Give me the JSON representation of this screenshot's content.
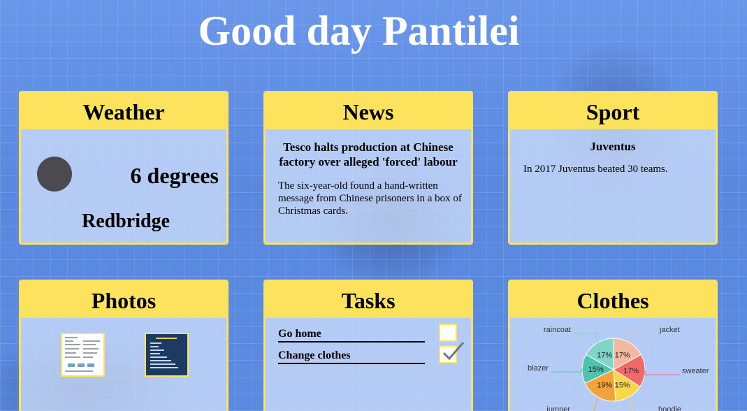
{
  "greeting": "Good day Pantilei",
  "weather": {
    "title": "Weather",
    "temperature": "6 degrees",
    "location": "Redbridge"
  },
  "news": {
    "title": "News",
    "headline": "Tesco halts production at Chinese factory over alleged 'forced' labour",
    "body": "The six-year-old found a hand-written message from Chinese prisoners in a box of Christmas cards."
  },
  "sport": {
    "title": "Sport",
    "team": "Juventus",
    "body": "In 2017 Juventus beated 30 teams."
  },
  "photos": {
    "title": "Photos"
  },
  "tasks": {
    "title": "Tasks",
    "items": [
      {
        "label": "Go home",
        "checked": false
      },
      {
        "label": "Change clothes",
        "checked": true
      }
    ]
  },
  "clothes": {
    "title": "Clothes",
    "chart_data": {
      "type": "pie",
      "categories": [
        "jacket",
        "sweater",
        "hoodie",
        "jumper",
        "blazer",
        "raincoat"
      ],
      "values": [
        17,
        17,
        15,
        19,
        15,
        17
      ],
      "labels": [
        "17%",
        "17%",
        "15%",
        "19%",
        "15%",
        "17%"
      ],
      "colors": [
        "#f2b8a0",
        "#f06a6a",
        "#f6d84a",
        "#f2a33a",
        "#4fc3b0",
        "#7fd6c8"
      ]
    }
  }
}
